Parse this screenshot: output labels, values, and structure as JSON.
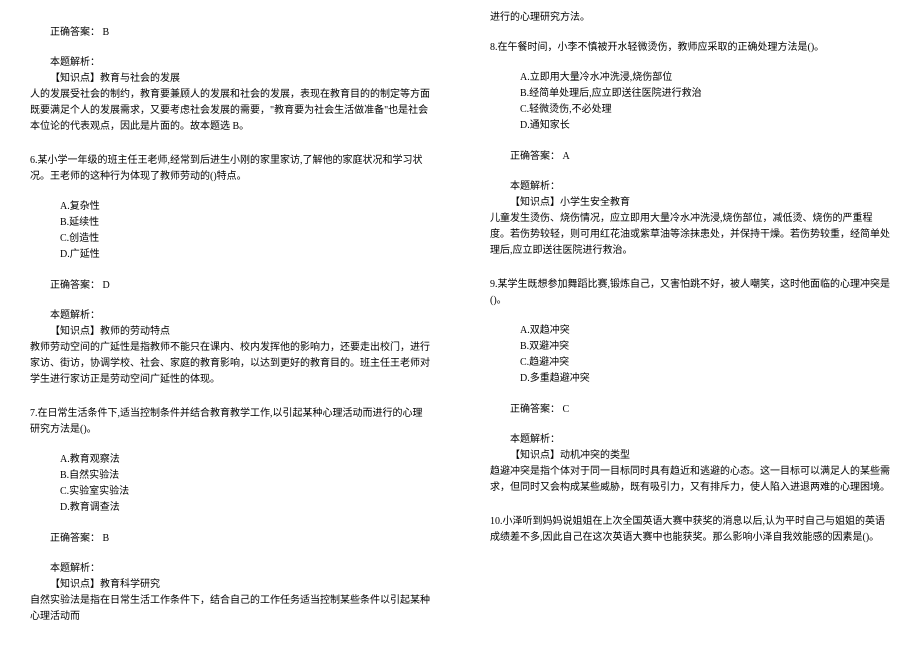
{
  "left": {
    "q5end": {
      "answer_label": "正确答案：",
      "answer_value": "B",
      "explain_label": "本题解析：",
      "kpoint_label": "【知识点】",
      "kpoint_value": "教育与社会的发展",
      "explain_text": "人的发展受社会的制约，教育要兼顾人的发展和社会的发展，表现在教育目的的制定等方面既要满足个人的发展需求，又要考虑社会发展的需要，\"教育要为社会生活做准备\"也是社会本位论的代表观点，因此是片面的。故本题选 B。"
    },
    "q6": {
      "stem": "6.某小学一年级的班主任王老师,经常到后进生小刚的家里家访,了解他的家庭状况和学习状况。王老师的这种行为体现了教师劳动的()特点。",
      "optA": "A.复杂性",
      "optB": "B.延续性",
      "optC": "C.创造性",
      "optD": "D.广延性",
      "answer_label": "正确答案：",
      "answer_value": "D",
      "explain_label": "本题解析：",
      "kpoint_label": "【知识点】",
      "kpoint_value": "教师的劳动特点",
      "explain_text": "教师劳动空间的广延性是指教师不能只在课内、校内发挥他的影响力，还要走出校门，进行家访、街访，协调学校、社会、家庭的教育影响，以达到更好的教育目的。班主任王老师对学生进行家访正是劳动空间广延性的体现。"
    },
    "q7": {
      "stem": "7.在日常生活条件下,适当控制条件并结合教育教学工作,以引起某种心理活动而进行的心理研究方法是()。",
      "optA": "A.教育观察法",
      "optB": "B.自然实验法",
      "optC": "C.实验室实验法",
      "optD": "D.教育调查法",
      "answer_label": "正确答案：",
      "answer_value": "B",
      "explain_label": "本题解析：",
      "kpoint_label": "【知识点】",
      "kpoint_value": "教育科学研究",
      "explain_text": "自然实验法是指在日常生活工作条件下，结合自己的工作任务适当控制某些条件以引起某种心理活动而"
    }
  },
  "right": {
    "q7cont": "进行的心理研究方法。",
    "q8": {
      "stem": "8.在午餐时间，小李不慎被开水轻微烫伤，教师应采取的正确处理方法是()。",
      "optA": "A.立即用大量冷水冲洗浸,烧伤部位",
      "optB": "B.经简单处理后,应立即送往医院进行救治",
      "optC": "C.轻微烫伤,不必处理",
      "optD": "D.通知家长",
      "answer_label": "正确答案：",
      "answer_value": "A",
      "explain_label": "本题解析：",
      "kpoint_label": "【知识点】",
      "kpoint_value": "小学生安全教育",
      "explain_text": "儿童发生烫伤、烧伤情况，应立即用大量冷水冲洗浸,烧伤部位，减低烫、烧伤的严重程度。若伤势较轻，则可用红花油或紫草油等涂抹患处，并保持干燥。若伤势较重，经简单处理后,应立即送往医院进行救治。"
    },
    "q9": {
      "stem": "9.某学生既想参加舞蹈比赛,锻炼自己，又害怕跳不好，被人嘲笑，这时他面临的心理冲突是()。",
      "optA": "A.双趋冲突",
      "optB": "B.双避冲突",
      "optC": "C.趋避冲突",
      "optD": "D.多重趋避冲突",
      "answer_label": "正确答案：",
      "answer_value": "C",
      "explain_label": "本题解析：",
      "kpoint_label": "【知识点】",
      "kpoint_value": "动机冲突的类型",
      "explain_text": "趋避冲突是指个体对于同一目标同时具有趋近和逃避的心态。这一目标可以满足人的某些需求，但同时又会构成某些威胁，既有吸引力，又有排斥力，使人陷入进退两难的心理困境。"
    },
    "q10": {
      "stem": "10.小泽听到妈妈说姐姐在上次全国英语大赛中获奖的消息以后,认为平时自己与姐姐的英语成绩差不多,因此自己在这次英语大赛中也能获奖。那么影响小泽自我效能感的因素是()。"
    }
  }
}
